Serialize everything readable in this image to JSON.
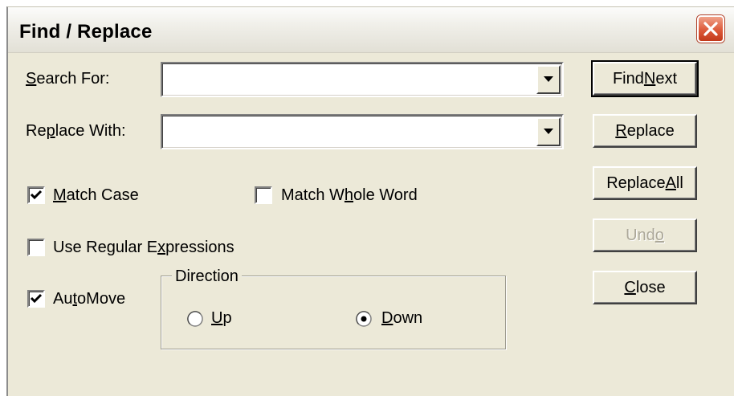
{
  "dialog": {
    "title": "Find / Replace"
  },
  "search": {
    "label_pre": "",
    "label_u": "S",
    "label_post": "earch For:",
    "value": ""
  },
  "replace": {
    "label_pre": "Re",
    "label_u": "p",
    "label_post": "lace With:",
    "value": ""
  },
  "options": {
    "match_case": {
      "pre": "",
      "u": "M",
      "post": "atch Case",
      "checked": true
    },
    "match_whole_word": {
      "pre": "Match W",
      "u": "h",
      "post": "ole Word",
      "checked": false
    },
    "use_regex": {
      "pre": "Use Regular E",
      "u": "x",
      "post": "pressions",
      "checked": false
    },
    "automove": {
      "pre": "Au",
      "u": "t",
      "post": "oMove",
      "checked": true
    }
  },
  "direction": {
    "legend": "Direction",
    "up": {
      "pre": "",
      "u": "U",
      "post": "p",
      "selected": false
    },
    "down": {
      "pre": "",
      "u": "D",
      "post": "own",
      "selected": true
    }
  },
  "buttons": {
    "find_next": {
      "pre": "Find ",
      "u": "N",
      "post": "ext"
    },
    "replace": {
      "pre": "",
      "u": "R",
      "post": "eplace"
    },
    "replace_all": {
      "pre": "Replace ",
      "u": "A",
      "post": "ll"
    },
    "undo": {
      "pre": "Und",
      "u": "o",
      "post": ""
    },
    "close": {
      "pre": "",
      "u": "C",
      "post": "lose"
    }
  },
  "icons": {
    "close": "close-icon",
    "dropdown": "chevron-down-icon",
    "check": "checkmark-icon"
  },
  "colors": {
    "close_button": "#dd5a3a",
    "dialog_bg": "#ece9d8",
    "disabled_text": "#aca899"
  }
}
